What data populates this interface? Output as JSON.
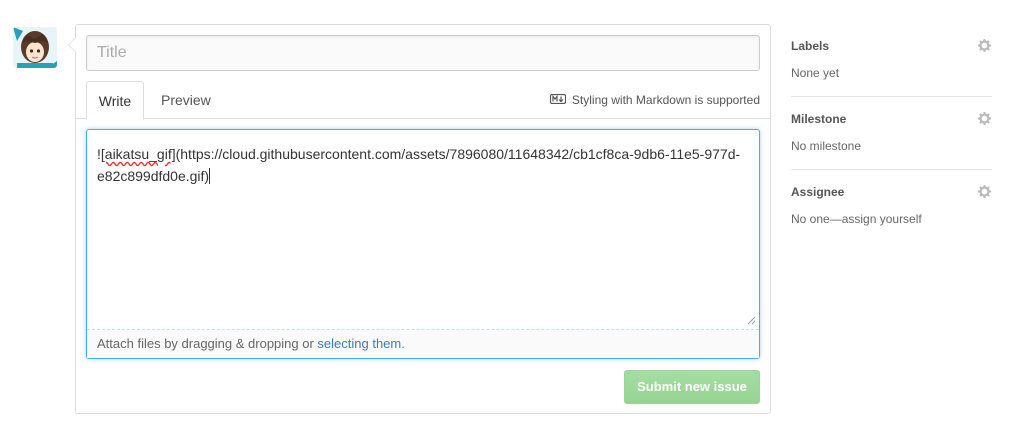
{
  "composer": {
    "title_placeholder": "Title",
    "tabs": [
      {
        "label": "Write"
      },
      {
        "label": "Preview"
      }
    ],
    "markdown_hint": "Styling with Markdown is supported",
    "editor": {
      "prefix": "!",
      "alt_text": "[aikatsu_gif]",
      "url_text": "(https://cloud.githubusercontent.com/assets/7896080/11648342/cb1cf8ca-9db6-11e5-977d-e82c899dfd0e.gif)"
    },
    "attach": {
      "text": "Attach files by dragging & dropping or ",
      "link": "selecting them."
    },
    "submit_label": "Submit new issue"
  },
  "sidebar": {
    "labels": {
      "title": "Labels",
      "value": "None yet"
    },
    "milestone": {
      "title": "Milestone",
      "value": "No milestone"
    },
    "assignee": {
      "title": "Assignee",
      "value": "No one—assign yourself"
    }
  },
  "colors": {
    "focus_border": "#51a7e8",
    "link": "#4078c0",
    "submit_disabled": "#9ed39a"
  },
  "icons": [
    "user-avatar",
    "markdown-icon",
    "resize-grip-icon",
    "gear-icon"
  ]
}
